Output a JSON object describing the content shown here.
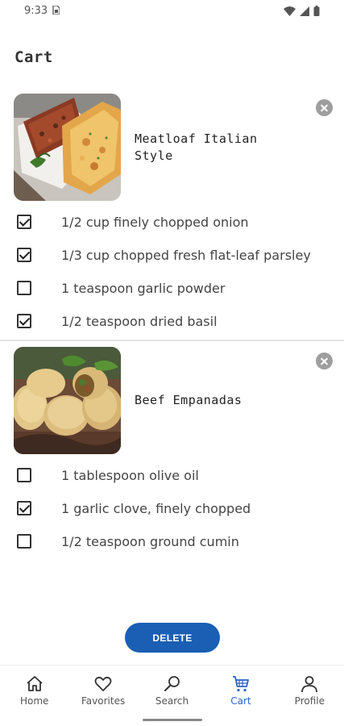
{
  "status_bar": {
    "time": "9:33",
    "sim_icon": "sim-card-icon",
    "icons": [
      "wifi-icon",
      "signal-icon",
      "battery-icon"
    ]
  },
  "page": {
    "title": "Cart"
  },
  "recipes": [
    {
      "title": "Meatloaf Italian Style",
      "image": "meatloaf-photo",
      "ingredients": [
        {
          "text": "1/2 cup finely chopped onion",
          "checked": true
        },
        {
          "text": "1/3 cup chopped fresh flat-leaf parsley",
          "checked": true
        },
        {
          "text": "1 teaspoon garlic powder",
          "checked": false
        },
        {
          "text": "1/2 teaspoon dried basil",
          "checked": true
        }
      ]
    },
    {
      "title": "Beef Empanadas",
      "image": "empanadas-photo",
      "ingredients": [
        {
          "text": "1 tablespoon olive oil",
          "checked": false
        },
        {
          "text": "1 garlic clove, finely chopped",
          "checked": true
        },
        {
          "text": "1/2 teaspoon ground cumin",
          "checked": false
        }
      ]
    }
  ],
  "actions": {
    "delete_label": "DELETE"
  },
  "bottom_nav": [
    {
      "label": "Home",
      "icon": "home-icon",
      "active": false
    },
    {
      "label": "Favorites",
      "icon": "heart-icon",
      "active": false
    },
    {
      "label": "Search",
      "icon": "search-icon",
      "active": false
    },
    {
      "label": "Cart",
      "icon": "cart-icon",
      "active": true
    },
    {
      "label": "Profile",
      "icon": "person-icon",
      "active": false
    }
  ],
  "colors": {
    "accent": "#1a5fb4",
    "active_nav": "#2a66c4",
    "remove_button": "#9e9e9e"
  }
}
